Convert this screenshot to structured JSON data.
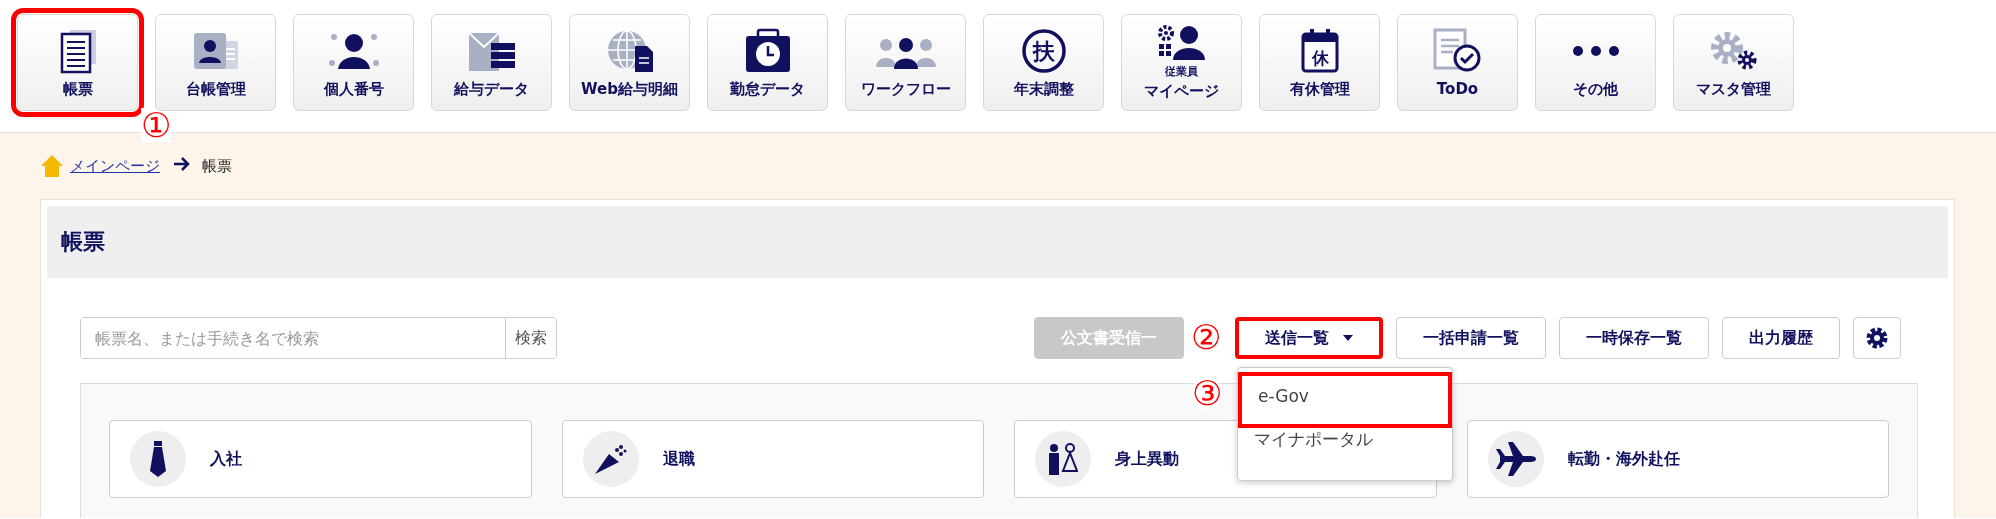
{
  "toolbar": [
    {
      "label": "帳票",
      "highlighted": true,
      "annotation": "①"
    },
    {
      "label": "台帳管理",
      "highlighted": false
    },
    {
      "label": "個人番号",
      "highlighted": false
    },
    {
      "label": "給与データ",
      "highlighted": false
    },
    {
      "label": "Web給与明細",
      "highlighted": false
    },
    {
      "label": "勤怠データ",
      "highlighted": false
    },
    {
      "label": "ワークフロー",
      "highlighted": false
    },
    {
      "label": "年末調整",
      "highlighted": false,
      "icon_text": "扶"
    },
    {
      "caption": "従業員",
      "label": "マイページ",
      "highlighted": false
    },
    {
      "label": "有休管理",
      "highlighted": false,
      "icon_text": "休"
    },
    {
      "label": "ToDo",
      "highlighted": false
    },
    {
      "label": "その他",
      "highlighted": false
    },
    {
      "label": "マスタ管理",
      "highlighted": false
    }
  ],
  "breadcrumb": [
    {
      "label": "メインページ",
      "kind": "link"
    },
    {
      "label": "帳票",
      "kind": "current"
    }
  ],
  "page_title": "帳票",
  "search": {
    "placeholder": "帳票名、または手続き名で検索",
    "button": "検索"
  },
  "actions": [
    {
      "kind": "button",
      "label": "公文書受信一",
      "disabled": true,
      "highlighted": false
    },
    {
      "kind": "dropdown",
      "label": "送信一覧",
      "highlighted": true,
      "annotation": "②",
      "menu": [
        {
          "label": "e-Gov",
          "highlighted": true,
          "annotation": "③"
        },
        {
          "label": "マイナポータル",
          "highlighted": false
        }
      ]
    },
    {
      "kind": "button",
      "label": "一括申請一覧",
      "disabled": false,
      "highlighted": false
    },
    {
      "kind": "button",
      "label": "一時保存一覧",
      "disabled": false,
      "highlighted": false
    },
    {
      "kind": "button",
      "label": "出力履歴",
      "disabled": false,
      "highlighted": false
    },
    {
      "kind": "settings",
      "highlighted": false
    }
  ],
  "categories": [
    {
      "label": "入社"
    },
    {
      "label": "退職"
    },
    {
      "label": "身上異動"
    },
    {
      "label": "転勤・海外赴任"
    }
  ]
}
